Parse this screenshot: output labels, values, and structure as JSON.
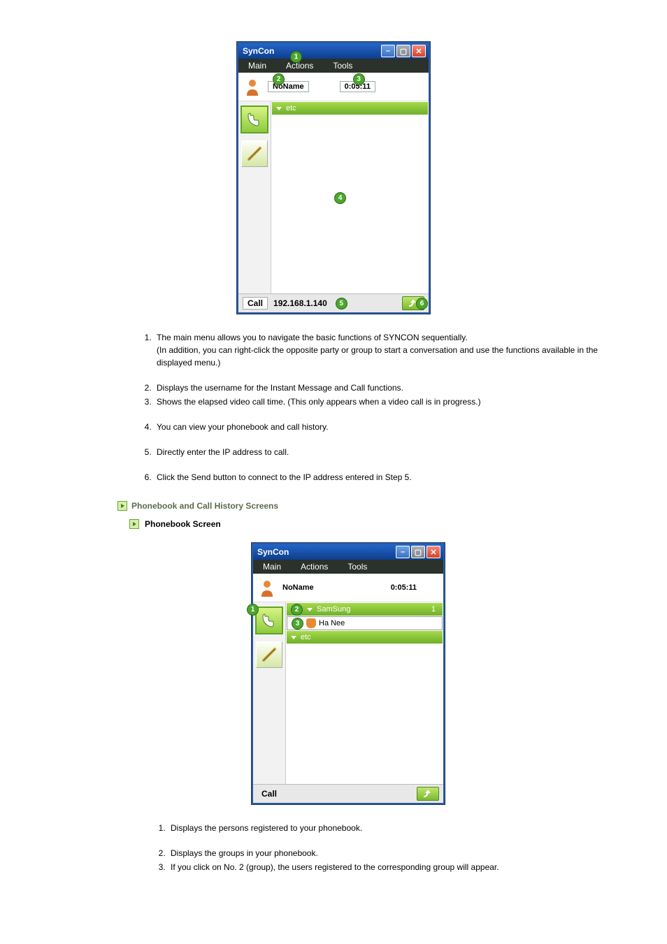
{
  "app": {
    "title": "SynCon",
    "menus": [
      "Main",
      "Actions",
      "Tools"
    ],
    "username": "NoName",
    "elapsed": "0:05:11",
    "group_etc": "etc",
    "call_label": "Call",
    "ip_value": "192.168.1.140"
  },
  "callouts1": {
    "n1": "1",
    "n2": "2",
    "n3": "3",
    "n4": "4",
    "n5": "5",
    "n6": "6"
  },
  "desc1": {
    "i1a": "The main menu allows you to navigate the basic functions of SYNCON sequentially.",
    "i1b": "(In addition, you can right-click the opposite party or group to start a conversation and use the functions available in the displayed menu.)",
    "i2": "Displays the username for the Instant Message and Call functions.",
    "i3": "Shows the elapsed video call time. (This only appears when a video call is in progress.)",
    "i4": "You can view your phonebook and call history.",
    "i5": "Directly enter the IP address to call.",
    "i6": "Click the Send button to connect to the IP address entered in Step 5."
  },
  "section2_title": "Phonebook and Call History Screens",
  "section2_sub": "Phonebook Screen",
  "app2": {
    "group_samsung": "SamSung",
    "group_samsung_count": "1",
    "contact_hanee": "Ha Nee"
  },
  "callouts2": {
    "n1": "1",
    "n2": "2",
    "n3": "3"
  },
  "desc2": {
    "i1": "Displays the persons registered to your phonebook.",
    "i2": "Displays the groups in your phonebook.",
    "i3": "If you click on No. 2 (group), the users registered to the corresponding group will appear."
  }
}
